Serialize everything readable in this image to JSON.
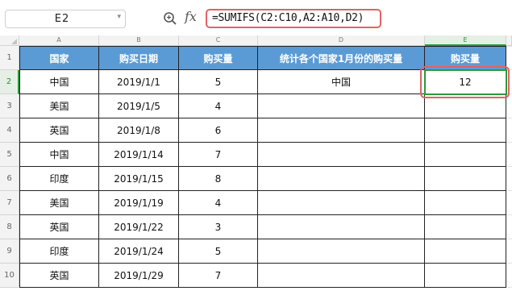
{
  "formula_bar": {
    "name_box": "E2",
    "fx_label": "fx",
    "formula": "=SUMIFS(C2:C10,A2:A10,D2)"
  },
  "columns": [
    "A",
    "B",
    "C",
    "D",
    "E"
  ],
  "rows": [
    "1",
    "2",
    "3",
    "4",
    "5",
    "6",
    "7",
    "8",
    "9",
    "10"
  ],
  "table": {
    "headers": [
      "国家",
      "购买日期",
      "购买量",
      "统计各个国家1月份的购买量",
      "购买量"
    ],
    "body": [
      [
        "中国",
        "2019/1/1",
        "5",
        "中国",
        "12"
      ],
      [
        "美国",
        "2019/1/5",
        "4",
        "",
        ""
      ],
      [
        "英国",
        "2019/1/8",
        "6",
        "",
        ""
      ],
      [
        "中国",
        "2019/1/14",
        "7",
        "",
        ""
      ],
      [
        "印度",
        "2019/1/15",
        "8",
        "",
        ""
      ],
      [
        "美国",
        "2019/1/19",
        "4",
        "",
        ""
      ],
      [
        "英国",
        "2019/1/22",
        "3",
        "",
        ""
      ],
      [
        "印度",
        "2019/1/24",
        "5",
        "",
        ""
      ],
      [
        "英国",
        "2019/1/29",
        "7",
        "",
        ""
      ]
    ]
  },
  "colors": {
    "header_fill": "#5b9bd5",
    "selection": "#2a9a3a",
    "annotation": "#e06363"
  },
  "icons": [
    "zoom-icon",
    "fx-icon",
    "dropdown-arrow-icon"
  ]
}
